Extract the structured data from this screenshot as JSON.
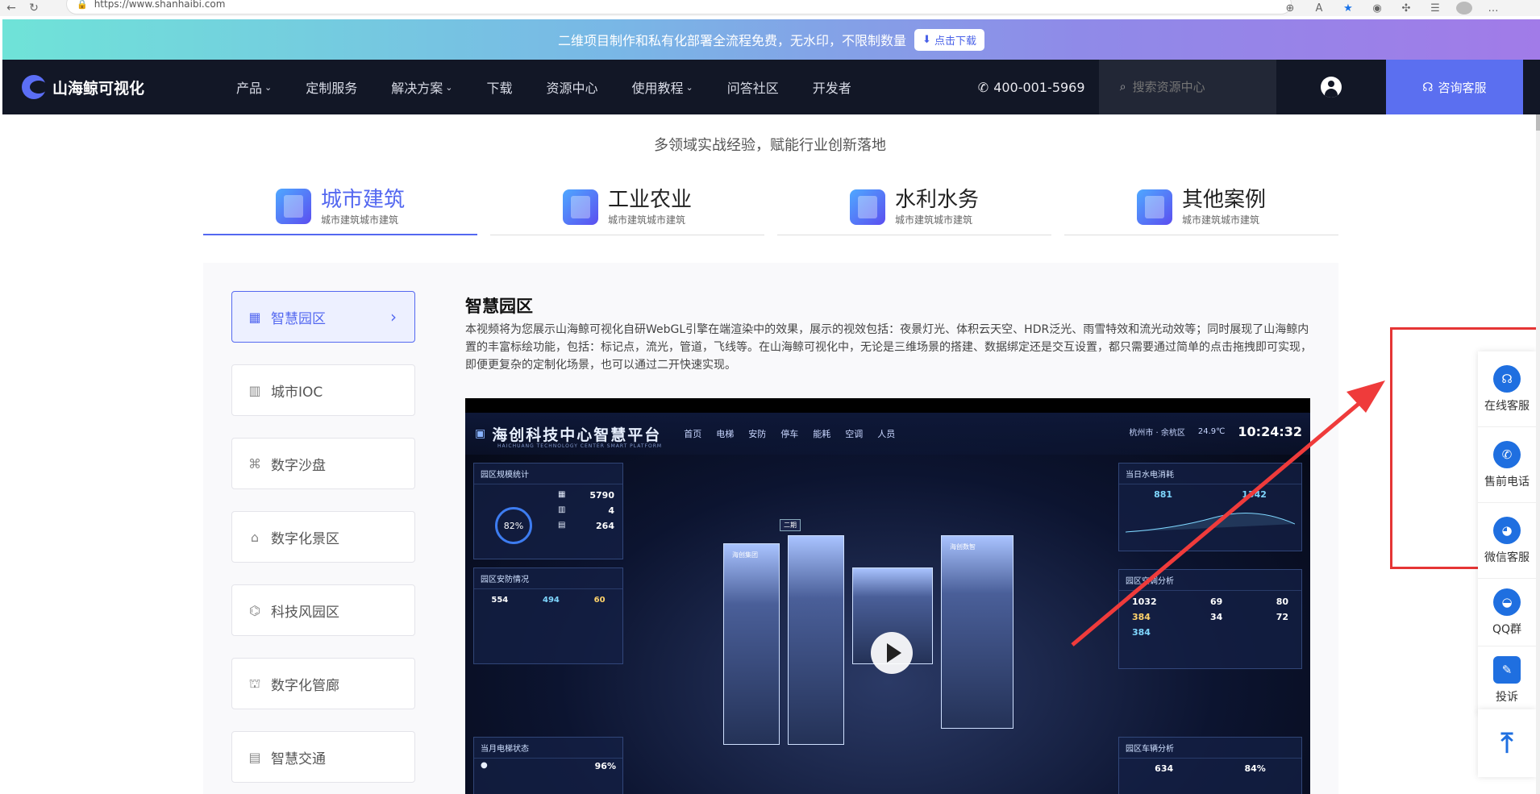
{
  "browser": {
    "url": "https://www.shanhaibi.com"
  },
  "promo": {
    "text": "二维项目制作和私有化部署全流程免费，无水印，不限制数量",
    "button": "点击下载"
  },
  "nav": {
    "logo": "山海鲸可视化",
    "items": [
      {
        "label": "产品",
        "dropdown": true
      },
      {
        "label": "定制服务",
        "dropdown": false
      },
      {
        "label": "解决方案",
        "dropdown": true
      },
      {
        "label": "下载",
        "dropdown": false
      },
      {
        "label": "资源中心",
        "dropdown": false
      },
      {
        "label": "使用教程",
        "dropdown": true
      },
      {
        "label": "问答社区",
        "dropdown": false
      },
      {
        "label": "开发者",
        "dropdown": false
      }
    ],
    "phone": "400-001-5969",
    "search_placeholder": "搜索资源中心",
    "consult": "咨询客服"
  },
  "section": {
    "subtitle": "多领域实战经验，赋能行业创新落地"
  },
  "categories": [
    {
      "title": "城市建筑",
      "sub": "城市建筑城市建筑",
      "active": true
    },
    {
      "title": "工业农业",
      "sub": "城市建筑城市建筑",
      "active": false
    },
    {
      "title": "水利水务",
      "sub": "城市建筑城市建筑",
      "active": false
    },
    {
      "title": "其他案例",
      "sub": "城市建筑城市建筑",
      "active": false
    }
  ],
  "sidebar": {
    "items": [
      {
        "label": "智慧园区",
        "icon": "building-grid-icon",
        "active": true
      },
      {
        "label": "城市IOC",
        "icon": "office-building-icon",
        "active": false
      },
      {
        "label": "数字沙盘",
        "icon": "sandbox-icon",
        "active": false
      },
      {
        "label": "数字化景区",
        "icon": "scenic-icon",
        "active": false
      },
      {
        "label": "科技风园区",
        "icon": "tech-park-icon",
        "active": false
      },
      {
        "label": "数字化管廊",
        "icon": "pipe-gallery-icon",
        "active": false
      },
      {
        "label": "智慧交通",
        "icon": "traffic-icon",
        "active": false
      }
    ]
  },
  "detail": {
    "title": "智慧园区",
    "desc": "本视频将为您展示山海鲸可视化自研WebGL引擎在端渲染中的效果，展示的视效包括：夜景灯光、体积云天空、HDR泛光、雨雪特效和流光动效等；同时展现了山海鲸内置的丰富标绘功能，包括：标记点，流光，管道，飞线等。在山海鲸可视化中，无论是三维场景的搭建、数据绑定还是交互设置，都只需要通过简单的点击拖拽即可实现，即便更复杂的定制化场景，也可以通过二开快速实现。"
  },
  "video": {
    "title": "海创科技中心智慧平台",
    "subtitle": "HAICHUANG TECHNOLOGY CENTER SMART PLATFORM",
    "menu": [
      "首页",
      "电梯",
      "安防",
      "停车",
      "能耗",
      "空调",
      "人员"
    ],
    "location": "杭州市 · 余杭区",
    "temperature": "24.9℃",
    "time": "10:24:32",
    "panels": {
      "park_stats": {
        "title": "园区规模统计",
        "rate": "82",
        "area": "5790",
        "buildings": "4",
        "offices": "264"
      },
      "water_power": {
        "title": "当日水电消耗",
        "water": "881",
        "power": "1342"
      },
      "security": {
        "title": "园区安防情况",
        "cameras": "554",
        "fixed": "494",
        "alarms": "60"
      },
      "aircon": {
        "title": "园区空调分析",
        "total": "1032",
        "on": "384",
        "off": "384",
        "comfort": "69",
        "fault": "34",
        "devices": "80",
        "energy": "72"
      },
      "elevator": {
        "title": "当月电梯状态",
        "safety": "96"
      },
      "parking": {
        "title": "园区车辆分析",
        "total": "634",
        "rate": "84"
      }
    },
    "buildings": [
      "海创集团",
      "海创数智",
      "二期"
    ]
  },
  "float": {
    "items": [
      {
        "label": "在线客服",
        "icon": "headset-icon"
      },
      {
        "label": "售前电话",
        "icon": "phone-icon"
      },
      {
        "label": "微信客服",
        "icon": "wechat-icon"
      },
      {
        "label": "QQ群",
        "icon": "qq-icon"
      },
      {
        "label": "投诉",
        "icon": "complaint-icon"
      }
    ]
  }
}
